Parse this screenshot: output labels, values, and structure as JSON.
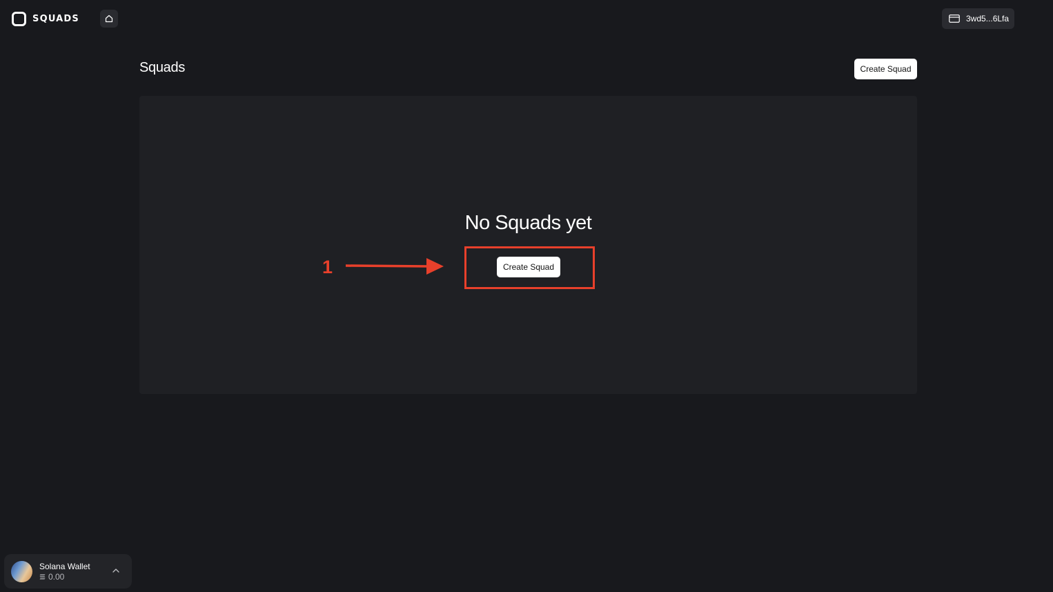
{
  "brand": {
    "name": "SQUADS"
  },
  "header": {
    "wallet_address": "3wd5...6Lfa"
  },
  "page": {
    "title": "Squads",
    "create_button_label": "Create Squad"
  },
  "empty_state": {
    "title": "No Squads yet",
    "create_button_label": "Create Squad"
  },
  "annotation": {
    "step_number": "1",
    "color": "#e8402b"
  },
  "wallet_card": {
    "name": "Solana Wallet",
    "balance": "0.00"
  },
  "icons": [
    "squads-logo-icon",
    "home-icon",
    "wallet-icon",
    "sol-icon",
    "chevron-up-icon",
    "arrow-right-icon"
  ],
  "colors": {
    "background": "#18191d",
    "panel": "#1f2024",
    "annotation": "#e8402b",
    "button": "#ffffff"
  }
}
